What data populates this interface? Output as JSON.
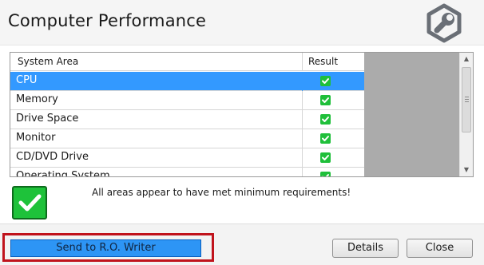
{
  "header": {
    "title": "Computer Performance",
    "logo_icon": "wrench-gear-icon"
  },
  "table": {
    "columns": [
      "System Area",
      "Result"
    ],
    "rows": [
      {
        "area": "CPU",
        "result": "pass",
        "selected": true
      },
      {
        "area": "Memory",
        "result": "pass",
        "selected": false
      },
      {
        "area": "Drive Space",
        "result": "pass",
        "selected": false
      },
      {
        "area": "Monitor",
        "result": "pass",
        "selected": false
      },
      {
        "area": "CD/DVD Drive",
        "result": "pass",
        "selected": false
      },
      {
        "area": "Operating System",
        "result": "pass",
        "selected": false
      }
    ],
    "result_icon": "checkmark-icon"
  },
  "status": {
    "icon": "checkmark-icon",
    "message": "All areas appear to have met minimum requirements!"
  },
  "footer": {
    "send_label": "Send to R.O. Writer",
    "details_label": "Details",
    "close_label": "Close"
  },
  "colors": {
    "selection": "#3399ff",
    "check_green": "#1fbf3a",
    "send_button": "#2d95f5",
    "highlight_border": "#c0131c"
  }
}
